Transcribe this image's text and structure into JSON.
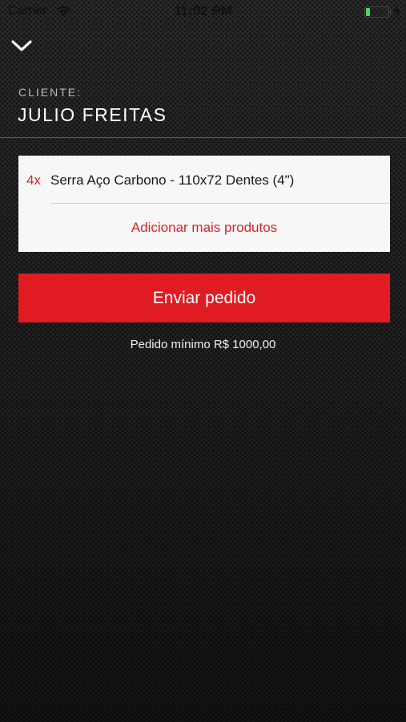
{
  "status_bar": {
    "carrier": "Carrier",
    "time": "11:02 PM",
    "icons": [
      "wifi-icon",
      "battery-icon",
      "charging-icon"
    ]
  },
  "header": {
    "close_icon": "chevron-down-icon",
    "client_label": "CLIENTE:",
    "client_name": "JULIO FREITAS"
  },
  "order": {
    "items": [
      {
        "quantity": "4x",
        "name": "Serra Aço Carbono - 110x72 Dentes (4\")"
      }
    ],
    "add_more_label": "Adicionar mais produtos"
  },
  "actions": {
    "send_label": "Enviar pedido",
    "min_order_text": "Pedido mínimo R$ 1000,00"
  },
  "colors": {
    "accent": "#e11b22",
    "accent_text": "#d7262a",
    "card_bg": "#f7f7f7",
    "battery_green": "#4cd964"
  }
}
